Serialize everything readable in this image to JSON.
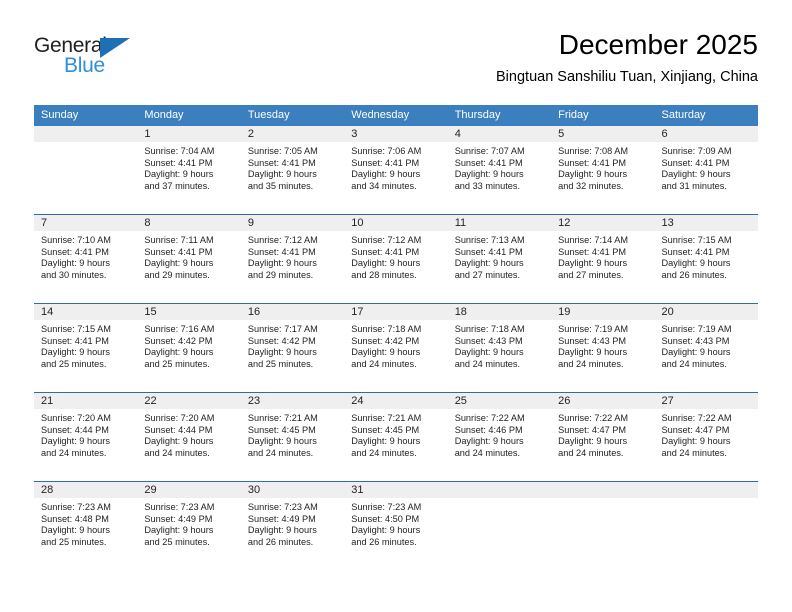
{
  "logo": {
    "word1": "General",
    "word2": "Blue",
    "triangle_color": "#1f6fb5",
    "word2_color": "#2e90dd"
  },
  "header": {
    "title": "December 2025",
    "subtitle": "Bingtuan Sanshiliu Tuan, Xinjiang, China"
  },
  "theme": {
    "header_row_bg": "#3b7fbe",
    "row_border": "#2f6ca8",
    "day_band_bg": "#efefef"
  },
  "weekdays": [
    "Sunday",
    "Monday",
    "Tuesday",
    "Wednesday",
    "Thursday",
    "Friday",
    "Saturday"
  ],
  "weeks": [
    [
      {
        "day": "",
        "lines": []
      },
      {
        "day": "1",
        "lines": [
          "Sunrise: 7:04 AM",
          "Sunset: 4:41 PM",
          "Daylight: 9 hours",
          "and 37 minutes."
        ]
      },
      {
        "day": "2",
        "lines": [
          "Sunrise: 7:05 AM",
          "Sunset: 4:41 PM",
          "Daylight: 9 hours",
          "and 35 minutes."
        ]
      },
      {
        "day": "3",
        "lines": [
          "Sunrise: 7:06 AM",
          "Sunset: 4:41 PM",
          "Daylight: 9 hours",
          "and 34 minutes."
        ]
      },
      {
        "day": "4",
        "lines": [
          "Sunrise: 7:07 AM",
          "Sunset: 4:41 PM",
          "Daylight: 9 hours",
          "and 33 minutes."
        ]
      },
      {
        "day": "5",
        "lines": [
          "Sunrise: 7:08 AM",
          "Sunset: 4:41 PM",
          "Daylight: 9 hours",
          "and 32 minutes."
        ]
      },
      {
        "day": "6",
        "lines": [
          "Sunrise: 7:09 AM",
          "Sunset: 4:41 PM",
          "Daylight: 9 hours",
          "and 31 minutes."
        ]
      }
    ],
    [
      {
        "day": "7",
        "lines": [
          "Sunrise: 7:10 AM",
          "Sunset: 4:41 PM",
          "Daylight: 9 hours",
          "and 30 minutes."
        ]
      },
      {
        "day": "8",
        "lines": [
          "Sunrise: 7:11 AM",
          "Sunset: 4:41 PM",
          "Daylight: 9 hours",
          "and 29 minutes."
        ]
      },
      {
        "day": "9",
        "lines": [
          "Sunrise: 7:12 AM",
          "Sunset: 4:41 PM",
          "Daylight: 9 hours",
          "and 29 minutes."
        ]
      },
      {
        "day": "10",
        "lines": [
          "Sunrise: 7:12 AM",
          "Sunset: 4:41 PM",
          "Daylight: 9 hours",
          "and 28 minutes."
        ]
      },
      {
        "day": "11",
        "lines": [
          "Sunrise: 7:13 AM",
          "Sunset: 4:41 PM",
          "Daylight: 9 hours",
          "and 27 minutes."
        ]
      },
      {
        "day": "12",
        "lines": [
          "Sunrise: 7:14 AM",
          "Sunset: 4:41 PM",
          "Daylight: 9 hours",
          "and 27 minutes."
        ]
      },
      {
        "day": "13",
        "lines": [
          "Sunrise: 7:15 AM",
          "Sunset: 4:41 PM",
          "Daylight: 9 hours",
          "and 26 minutes."
        ]
      }
    ],
    [
      {
        "day": "14",
        "lines": [
          "Sunrise: 7:15 AM",
          "Sunset: 4:41 PM",
          "Daylight: 9 hours",
          "and 25 minutes."
        ]
      },
      {
        "day": "15",
        "lines": [
          "Sunrise: 7:16 AM",
          "Sunset: 4:42 PM",
          "Daylight: 9 hours",
          "and 25 minutes."
        ]
      },
      {
        "day": "16",
        "lines": [
          "Sunrise: 7:17 AM",
          "Sunset: 4:42 PM",
          "Daylight: 9 hours",
          "and 25 minutes."
        ]
      },
      {
        "day": "17",
        "lines": [
          "Sunrise: 7:18 AM",
          "Sunset: 4:42 PM",
          "Daylight: 9 hours",
          "and 24 minutes."
        ]
      },
      {
        "day": "18",
        "lines": [
          "Sunrise: 7:18 AM",
          "Sunset: 4:43 PM",
          "Daylight: 9 hours",
          "and 24 minutes."
        ]
      },
      {
        "day": "19",
        "lines": [
          "Sunrise: 7:19 AM",
          "Sunset: 4:43 PM",
          "Daylight: 9 hours",
          "and 24 minutes."
        ]
      },
      {
        "day": "20",
        "lines": [
          "Sunrise: 7:19 AM",
          "Sunset: 4:43 PM",
          "Daylight: 9 hours",
          "and 24 minutes."
        ]
      }
    ],
    [
      {
        "day": "21",
        "lines": [
          "Sunrise: 7:20 AM",
          "Sunset: 4:44 PM",
          "Daylight: 9 hours",
          "and 24 minutes."
        ]
      },
      {
        "day": "22",
        "lines": [
          "Sunrise: 7:20 AM",
          "Sunset: 4:44 PM",
          "Daylight: 9 hours",
          "and 24 minutes."
        ]
      },
      {
        "day": "23",
        "lines": [
          "Sunrise: 7:21 AM",
          "Sunset: 4:45 PM",
          "Daylight: 9 hours",
          "and 24 minutes."
        ]
      },
      {
        "day": "24",
        "lines": [
          "Sunrise: 7:21 AM",
          "Sunset: 4:45 PM",
          "Daylight: 9 hours",
          "and 24 minutes."
        ]
      },
      {
        "day": "25",
        "lines": [
          "Sunrise: 7:22 AM",
          "Sunset: 4:46 PM",
          "Daylight: 9 hours",
          "and 24 minutes."
        ]
      },
      {
        "day": "26",
        "lines": [
          "Sunrise: 7:22 AM",
          "Sunset: 4:47 PM",
          "Daylight: 9 hours",
          "and 24 minutes."
        ]
      },
      {
        "day": "27",
        "lines": [
          "Sunrise: 7:22 AM",
          "Sunset: 4:47 PM",
          "Daylight: 9 hours",
          "and 24 minutes."
        ]
      }
    ],
    [
      {
        "day": "28",
        "lines": [
          "Sunrise: 7:23 AM",
          "Sunset: 4:48 PM",
          "Daylight: 9 hours",
          "and 25 minutes."
        ]
      },
      {
        "day": "29",
        "lines": [
          "Sunrise: 7:23 AM",
          "Sunset: 4:49 PM",
          "Daylight: 9 hours",
          "and 25 minutes."
        ]
      },
      {
        "day": "30",
        "lines": [
          "Sunrise: 7:23 AM",
          "Sunset: 4:49 PM",
          "Daylight: 9 hours",
          "and 26 minutes."
        ]
      },
      {
        "day": "31",
        "lines": [
          "Sunrise: 7:23 AM",
          "Sunset: 4:50 PM",
          "Daylight: 9 hours",
          "and 26 minutes."
        ]
      },
      {
        "day": "",
        "lines": []
      },
      {
        "day": "",
        "lines": []
      },
      {
        "day": "",
        "lines": []
      }
    ]
  ]
}
